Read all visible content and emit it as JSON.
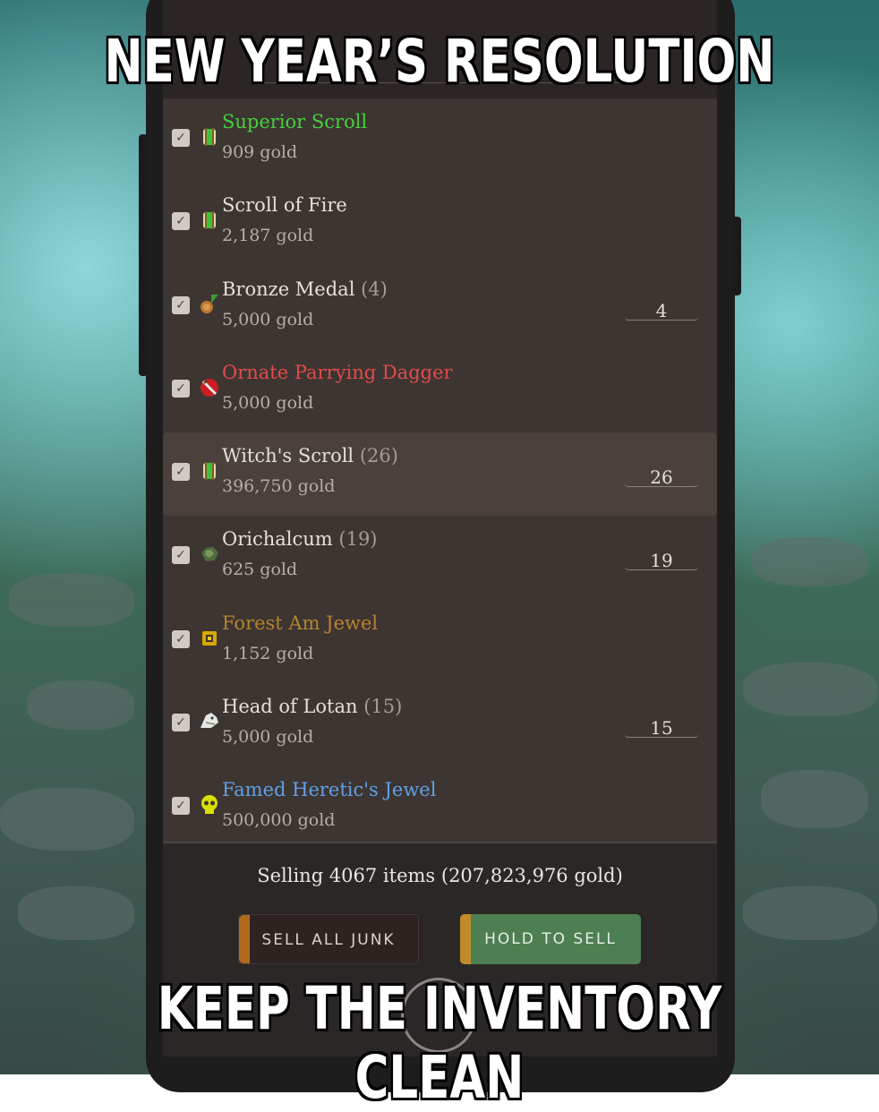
{
  "meme": {
    "top_text": "NEW YEAR’S RESOLUTION",
    "bottom_text": "KEEP THE INVENTORY CLEAN"
  },
  "colors": {
    "rarity_green": "#45d13d",
    "rarity_red": "#e24a4a",
    "rarity_orange": "#b8822f",
    "rarity_blue": "#5fa0e6",
    "hold_to_sell_bg": "#4d7f52"
  },
  "items": [
    {
      "name": "Superior Scroll",
      "count": "",
      "price": "909 gold",
      "qty": "",
      "rarity": "green",
      "icon": "scroll-icon",
      "checked": true
    },
    {
      "name": "Scroll of Fire",
      "count": "",
      "price": "2,187 gold",
      "qty": "",
      "rarity": "common",
      "icon": "scroll-icon",
      "checked": true
    },
    {
      "name": "Bronze Medal",
      "count": "(4)",
      "price": "5,000 gold",
      "qty": "4",
      "rarity": "common",
      "icon": "medal-icon",
      "checked": true
    },
    {
      "name": "Ornate Parrying Dagger",
      "count": "",
      "price": "5,000 gold",
      "qty": "",
      "rarity": "red",
      "icon": "dagger-icon",
      "checked": true
    },
    {
      "name": "Witch's Scroll",
      "count": "(26)",
      "price": "396,750 gold",
      "qty": "26",
      "rarity": "common",
      "icon": "scroll-icon",
      "checked": true
    },
    {
      "name": "Orichalcum",
      "count": "(19)",
      "price": "625 gold",
      "qty": "19",
      "rarity": "common",
      "icon": "ore-icon",
      "checked": true
    },
    {
      "name": "Forest Am Jewel",
      "count": "",
      "price": "1,152 gold",
      "qty": "",
      "rarity": "orange",
      "icon": "jewel-icon",
      "checked": true
    },
    {
      "name": "Head of Lotan",
      "count": "(15)",
      "price": "5,000 gold",
      "qty": "15",
      "rarity": "common",
      "icon": "dragon-head-icon",
      "checked": true
    },
    {
      "name": "Famed Heretic's Jewel",
      "count": "",
      "price": "500,000 gold",
      "qty": "",
      "rarity": "blue",
      "icon": "skull-icon",
      "checked": true
    }
  ],
  "footer": {
    "summary": "Selling 4067 items (207,823,976 gold)",
    "sell_all_junk": "SELL ALL JUNK",
    "hold_to_sell": "HOLD TO SELL"
  }
}
